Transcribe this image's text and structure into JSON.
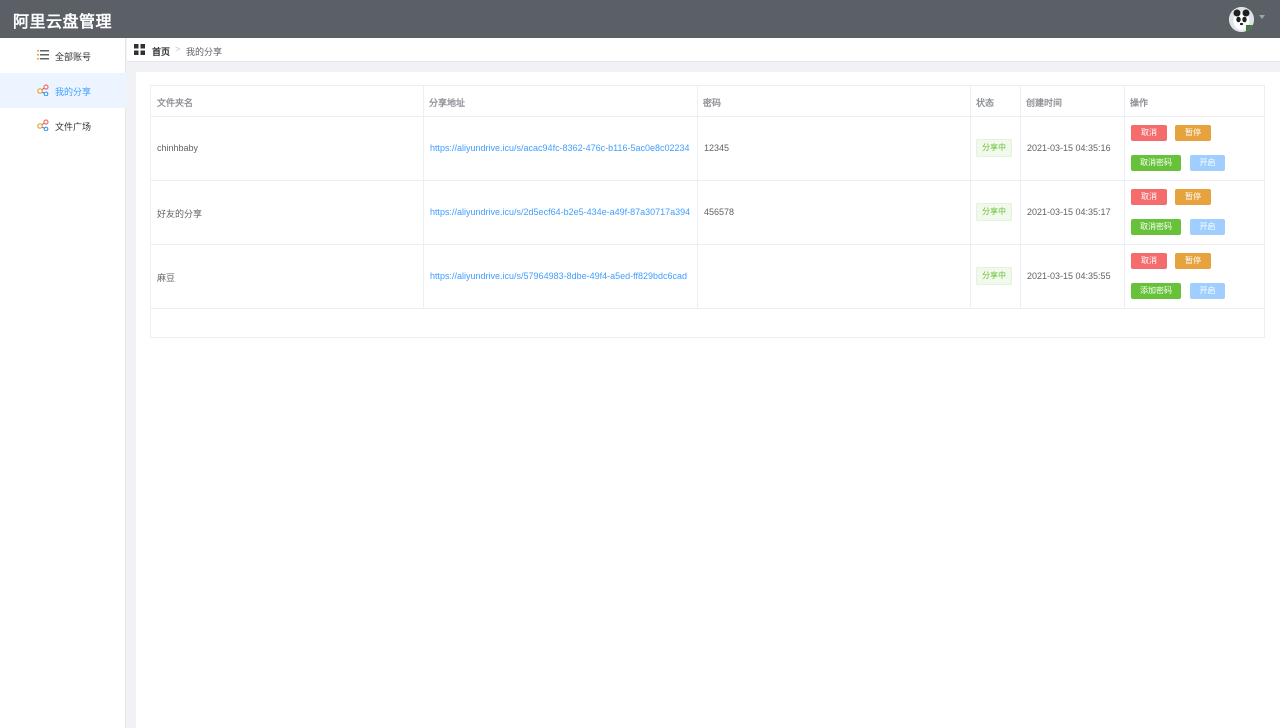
{
  "app": {
    "title": "阿里云盘管理"
  },
  "sidebar": {
    "items": [
      {
        "label": "全部账号",
        "icon": "list-icon",
        "active": false
      },
      {
        "label": "我的分享",
        "icon": "share-icon",
        "active": true
      },
      {
        "label": "文件广场",
        "icon": "share-icon",
        "active": false
      }
    ]
  },
  "breadcrumb": {
    "home": "首页",
    "separator": ">",
    "current": "我的分享"
  },
  "table": {
    "headers": [
      "文件夹名",
      "分享地址",
      "密码",
      "状态",
      "创建时间",
      "操作"
    ],
    "rows": [
      {
        "name": "chinhbaby",
        "url": "https://aliyundrive.icu/s/acac94fc-8362-476c-b116-5ac0e8c02234",
        "password": "12345",
        "status": "分享中",
        "created": "2021-03-15 04:35:16",
        "actions": [
          "取消",
          "暂停",
          "取消密码",
          "开启"
        ]
      },
      {
        "name": "好友的分享",
        "url": "https://aliyundrive.icu/s/2d5ecf64-b2e5-434e-a49f-87a30717a394",
        "password": "456578",
        "status": "分享中",
        "created": "2021-03-15 04:35:17",
        "actions": [
          "取消",
          "暂停",
          "取消密码",
          "开启"
        ]
      },
      {
        "name": "麻豆",
        "url": "https://aliyundrive.icu/s/57964983-8dbe-49f4-a5ed-ff829bdc6cad",
        "password": "",
        "status": "分享中",
        "created": "2021-03-15 04:35:55",
        "actions": [
          "取消",
          "暂停",
          "添加密码",
          "开启"
        ]
      }
    ]
  },
  "colors": {
    "header_bg": "#5b6066",
    "accent": "#409eff",
    "danger": "#f56c6c",
    "warning": "#e6a23c",
    "success": "#67c23a",
    "primary_disabled": "#a0cfff"
  }
}
